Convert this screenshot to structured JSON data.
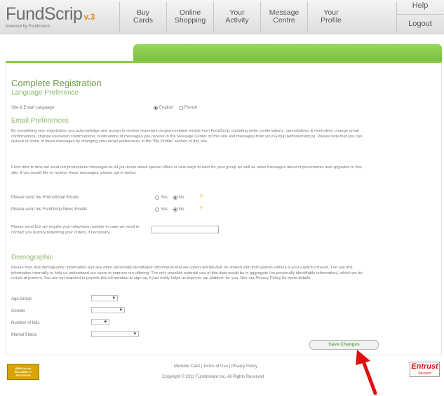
{
  "header": {
    "logo": "FundScrip",
    "version": "v.3",
    "tagline": "powered by Fundmarch",
    "nav": [
      "Buy\nCards",
      "Online\nShopping",
      "Your\nActivity",
      "Message\nCentre",
      "Your\nProfile"
    ],
    "help": "Help",
    "logout": "Logout"
  },
  "page": {
    "title": "Complete Registration",
    "language": {
      "heading": "Language Preference",
      "label": "Site & Email Language",
      "options": [
        "English",
        "French"
      ],
      "selected": "English"
    },
    "email": {
      "heading": "Email Preferences",
      "para1": "By completing your registration you acknowledge and accept to receive important program-related emails from FundScrip, including order confirmations, cancellations & reminders, change email confirmations, change password confirmations, notifications of messages you receive in the Message Center on this site and messages from your Group Administrator(s). Please note that you can opt-out of some of these messages by changing your email preferences in the \"My Profile\" section of this site.",
      "para2": "From time to time we send out promotional messages to let you know about special offers or new ways to earn for your group as well as news messages about improvements and upgrades to this site. If you would like to receive these messages, please opt-in below.",
      "q1": "Please send me Promotional Emails",
      "q2": "Please send me FundScrip News Emails",
      "yes": "Yes",
      "no": "No",
      "q1_value": "No",
      "q2_value": "No",
      "info": "?",
      "phone_label": "Please send first we require your telephone number in case we need to contact you quickly regarding your orders, if necessary.",
      "phone_value": ""
    },
    "demographic": {
      "heading": "Demographic",
      "para": "Please note that demographic information and any other personally identifiable information that we collect will NEVER be shared with third parties without a your explicit consent. The use this information internally to help us understand our users to improve our offering. The only possible external use of this data would be in aggregate (no personally identifiable information), which we do not do at present. You are not required to provide this information to sign up, it just really helps us improve our platform for you. See our Privacy Policy for more details.",
      "fields": [
        "Age Group",
        "Gender",
        "Number of kids",
        "Marital Status"
      ],
      "values": [
        "",
        "",
        "",
        ""
      ]
    },
    "save_button": "Save Changes"
  },
  "footer": {
    "links": "Member Card | Terms of Use | Privacy Policy",
    "copyright": "Copyright © 2011 Fundstream Inc. All Rights Reserved",
    "badge_left": [
      "BBBOnLine",
      "RELIABILITY",
      "PROGRAM"
    ],
    "badge_right_title": "Entrust",
    "badge_right_sub": "Secured"
  },
  "colors": {
    "accent_green": "#8ccb4e",
    "heading_green": "#6a9a4a",
    "logo_orange": "#e88a1a",
    "arrow_red": "#e01010"
  }
}
